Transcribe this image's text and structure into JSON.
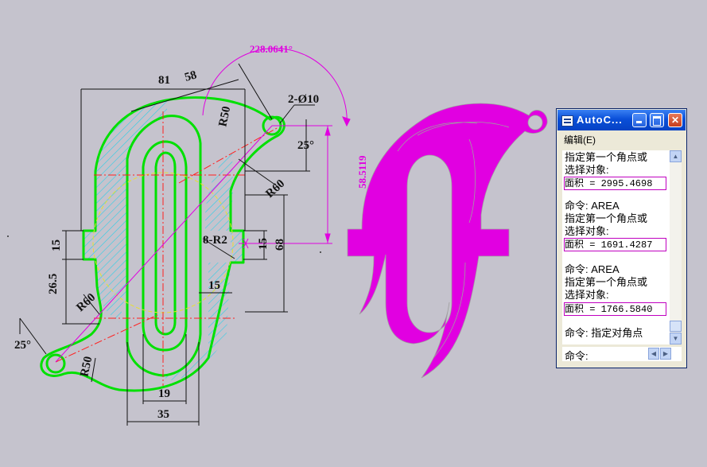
{
  "drawing": {
    "dims": {
      "d81": "81",
      "d58": "58",
      "r50_top": "R50",
      "hole": "2-Ø10",
      "ang25_top": "25°",
      "r60_right": "R60",
      "d15_left": "15",
      "d26_5": "26.5",
      "r60_left": "R60",
      "r2": "8-R2",
      "d15_right": "15",
      "d68": "68",
      "d15_inner": "15",
      "ang25_left": "25°",
      "r50_bottom": "R50",
      "d19": "19",
      "d35": "35"
    },
    "measure_angle": "228.0641°",
    "measure_dist": "58.5119",
    "colors": {
      "background": "#c5c3cd",
      "outline": "#00e000",
      "hatch": "#30d0e8",
      "center": "#ff2020",
      "measure": "#e000e0",
      "region": "#e100e1"
    }
  },
  "text_window": {
    "title": "AutoC...",
    "menu": "编辑(E)",
    "lines": [
      "指定第一个角点或",
      "选择对象:",
      "面积 = 2995.4698",
      "命令:  AREA",
      "指定第一个角点或",
      "选择对象:",
      "面积 = 1691.4287",
      "命令:  AREA",
      "指定第一个角点或",
      "选择对象:",
      "面积 = 1766.5840",
      "命令: 指定对角点"
    ],
    "command_label": "命令:"
  }
}
